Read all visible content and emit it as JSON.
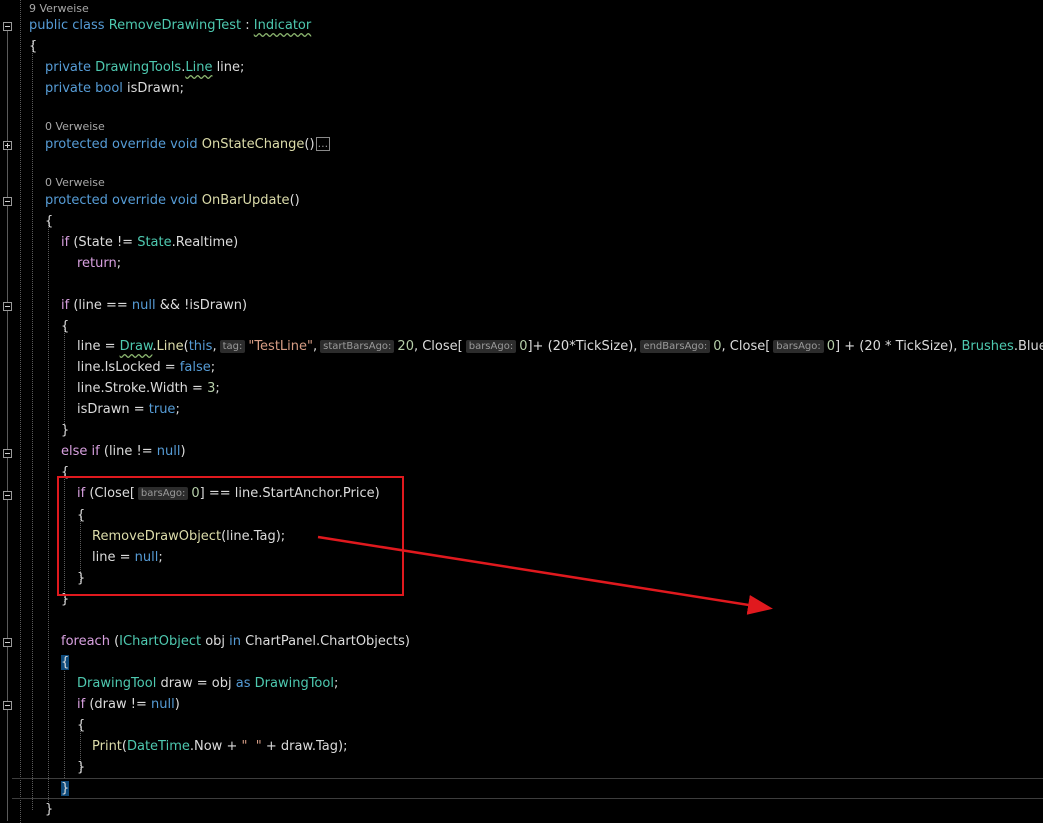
{
  "editor": {
    "lens": {
      "class_refs": "9 Verweise",
      "onstatechange_refs": "0 Verweise",
      "onbarupdate_refs": "0 Verweise"
    },
    "code": {
      "class_public": "public",
      "class_kw": "class",
      "class_name": "RemoveDrawingTest",
      "class_colon": " : ",
      "class_base": "Indicator",
      "open_brace": "{",
      "close_brace": "}",
      "private": "private",
      "field1_type_ns": "DrawingTools",
      "dot": ".",
      "field1_type": "Line",
      "field1_name": " line;",
      "bool_kw": "bool",
      "field2_name": " isDrawn;",
      "protected": "protected",
      "override": "override",
      "void": "void",
      "m1_name": "OnStateChange",
      "parens": "()",
      "collapsed_marker": "...",
      "m2_name": "OnBarUpdate",
      "if": "if",
      "state_open": " (State != ",
      "state_type": "State",
      "state_realtime": ".Realtime)",
      "return": "return",
      "semi": ";",
      "if2_cond_a": " (line == ",
      "null": "null",
      "if2_cond_b": " && !isDrawn)",
      "assign_line": "line = ",
      "draw_type": "Draw",
      "draw_method": "Line",
      "paren_open": "(",
      "this": "this",
      "comma": ",",
      "hint_tag": "tag:",
      "testline_str": "\"TestLine\"",
      "hint_startbarsago": "startBarsAgo:",
      "num_20": "20",
      "close_open": ", Close[",
      "hint_barsago": "barsAgo:",
      "num_0": "0",
      "close_rest1": "]+ (20*TickSize),",
      "hint_endbarsago": "endBarsAgo:",
      "close_open2": ", Close[",
      "close_rest2": "] + (20 * TickSize), ",
      "brushes": "Brushes",
      "blue": ".Blue);",
      "islocked": "line.IsLocked = ",
      "false": "false",
      "stroke": "line.Stroke.Width = ",
      "num_3": "3",
      "isdrawn_assign": "isDrawn = ",
      "true": "true",
      "else": "else",
      "elseif_cond": " (line != ",
      "elseif_end": ")",
      "if3_open": " (Close[",
      "if3_rest": "] == line.StartAnchor.Price)",
      "remove_method": "RemoveDrawObject",
      "remove_args": "(line.Tag);",
      "line_null": "line = ",
      "foreach": "foreach",
      "foreach_open": " (",
      "ichart": "IChartObject",
      "obj_in": " obj ",
      "in": "in",
      "chartpanel": " ChartPanel.ChartObjects)",
      "drawingtool": "DrawingTool",
      "draw_assign": " draw = obj ",
      "as": "as",
      "if4_cond": " (draw != ",
      "print": "Print",
      "datetime": "DateTime",
      "now_concat": ".Now + ",
      "space_str": "\"  \"",
      "plus_tag": " + draw.Tag);"
    }
  },
  "colors": {
    "background": "#000000",
    "annotation_red": "#e0191e",
    "keyword": "#569cd6",
    "control": "#d8a0df",
    "type": "#4ec9b0",
    "method": "#dcdcaa",
    "string": "#d69d85",
    "number": "#b5cea8"
  }
}
